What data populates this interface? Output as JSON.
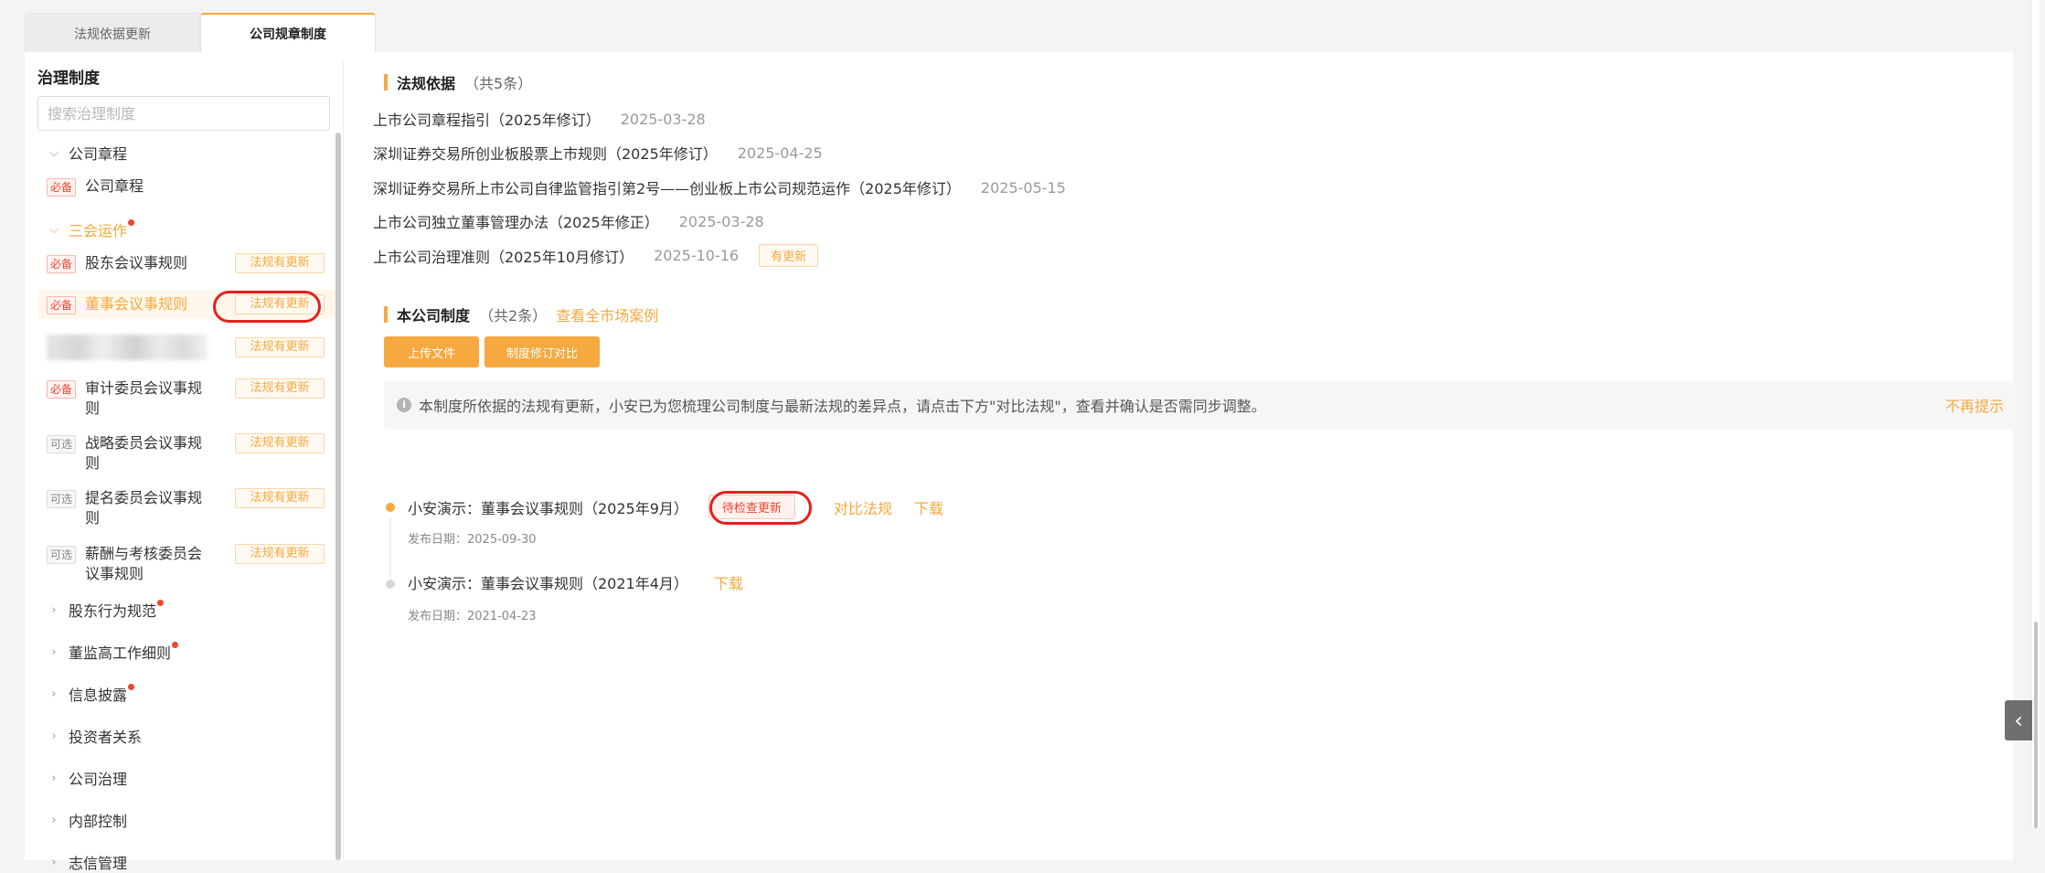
{
  "tabs": [
    {
      "label": "法规依据更新"
    },
    {
      "label": "公司规章制度"
    }
  ],
  "sidebar": {
    "title": "治理制度",
    "search_placeholder": "搜索治理制度",
    "groups": [
      {
        "label": "公司章程"
      },
      {
        "label": "三会运作"
      },
      {
        "label": "股东行为规范"
      },
      {
        "label": "董监高工作细则"
      },
      {
        "label": "信息披露"
      },
      {
        "label": "投资者关系"
      },
      {
        "label": "公司治理"
      },
      {
        "label": "内部控制"
      },
      {
        "label": "志信管理"
      }
    ],
    "leaves": [
      {
        "badge": "必备",
        "name": "公司章程"
      },
      {
        "badge": "必备",
        "name": "股东会议事规则",
        "update": "法规有更新"
      },
      {
        "badge": "必备",
        "name": "董事会议事规则",
        "update": "法规有更新"
      },
      {
        "update": "法规有更新"
      },
      {
        "badge": "必备",
        "name": "审计委员会议事规则",
        "update": "法规有更新"
      },
      {
        "badge": "可选",
        "name": "战略委员会议事规则",
        "update": "法规有更新"
      },
      {
        "badge": "可选",
        "name": "提名委员会议事规则",
        "update": "法规有更新"
      },
      {
        "badge": "可选",
        "name": "薪酬与考核委员会议事规则",
        "update": "法规有更新"
      }
    ]
  },
  "laws": {
    "title": "法规依据",
    "count": "（共5条）",
    "items": [
      {
        "name": "上市公司章程指引（2025年修订）",
        "date": "2025-03-28"
      },
      {
        "name": "深圳证券交易所创业板股票上市规则（2025年修订）",
        "date": "2025-04-25"
      },
      {
        "name": "深圳证券交易所上市公司自律监管指引第2号——创业板上市公司规范运作（2025年修订）",
        "date": "2025-05-15"
      },
      {
        "name": "上市公司独立董事管理办法（2025年修正）",
        "date": "2025-03-28"
      },
      {
        "name": "上市公司治理准则（2025年10月修订）",
        "date": "2025-10-16",
        "tag": "有更新"
      }
    ]
  },
  "company": {
    "title": "本公司制度",
    "count": "（共2条）",
    "link": "查看全市场案例",
    "upload_label": "上传文件",
    "compare_label": "制度修订对比",
    "notice": "本制度所依据的法规有更新，小安已为您梳理公司制度与最新法规的差异点，请点击下方\"对比法规\"，查看并确认是否需同步调整。",
    "dismiss": "不再提示",
    "versions": [
      {
        "name": "小安演示：董事会议事规则（2025年9月）",
        "status": "待检查更新",
        "compare": "对比法规",
        "download": "下载",
        "date": "发布日期：2025-09-30"
      },
      {
        "name": "小安演示：董事会议事规则（2021年4月）",
        "download": "下载",
        "date": "发布日期：2021-04-23"
      }
    ]
  },
  "colors": {
    "accent": "#f5a93f",
    "alert": "#f0442f",
    "highlight": "#e41f1f"
  },
  "icons": {
    "expand": "chevron-down-icon",
    "collapse": "chevron-right-icon",
    "info": "info-icon",
    "panel": "chevron-left-icon"
  }
}
